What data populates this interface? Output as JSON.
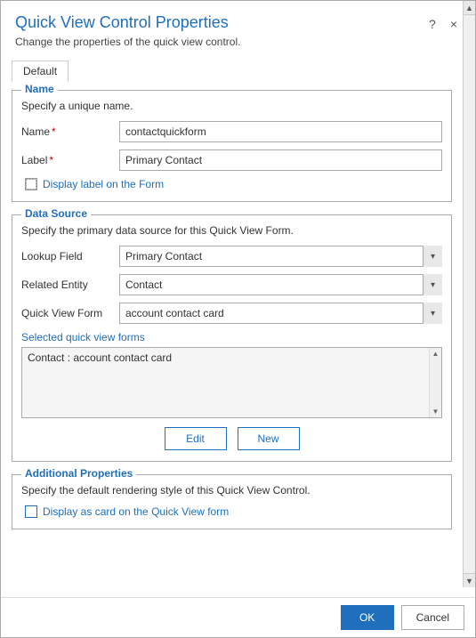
{
  "dialog": {
    "title": "Quick View Control Properties",
    "subtitle": "Change the properties of the quick view control.",
    "help_icon": "?",
    "close_icon": "×"
  },
  "tabs": [
    {
      "label": "Default",
      "active": true
    }
  ],
  "name_section": {
    "legend": "Name",
    "description": "Specify a unique name.",
    "name_label": "Name",
    "name_value": "contactquickform",
    "label_label": "Label",
    "label_value": "Primary Contact",
    "display_label_checkbox": "Display label on the Form",
    "required_star": "*"
  },
  "data_source_section": {
    "legend": "Data Source",
    "description": "Specify the primary data source for this Quick View Form.",
    "lookup_field_label": "Lookup Field",
    "lookup_field_value": "Primary Contact",
    "related_entity_label": "Related Entity",
    "related_entity_value": "Contact",
    "quick_view_form_label": "Quick View Form",
    "quick_view_form_value": "account contact card",
    "selected_forms_label": "Selected quick view forms",
    "selected_forms_item": "Contact : account contact card",
    "edit_button": "Edit",
    "new_button": "New",
    "lookup_options": [
      "Primary Contact"
    ],
    "related_entity_options": [
      "Contact"
    ],
    "quick_view_form_options": [
      "account contact card"
    ]
  },
  "additional_section": {
    "legend": "Additional Properties",
    "description": "Specify the default rendering style of this Quick View Control.",
    "display_as_card_label": "Display as card on the Quick View form"
  },
  "footer": {
    "ok_label": "OK",
    "cancel_label": "Cancel"
  }
}
